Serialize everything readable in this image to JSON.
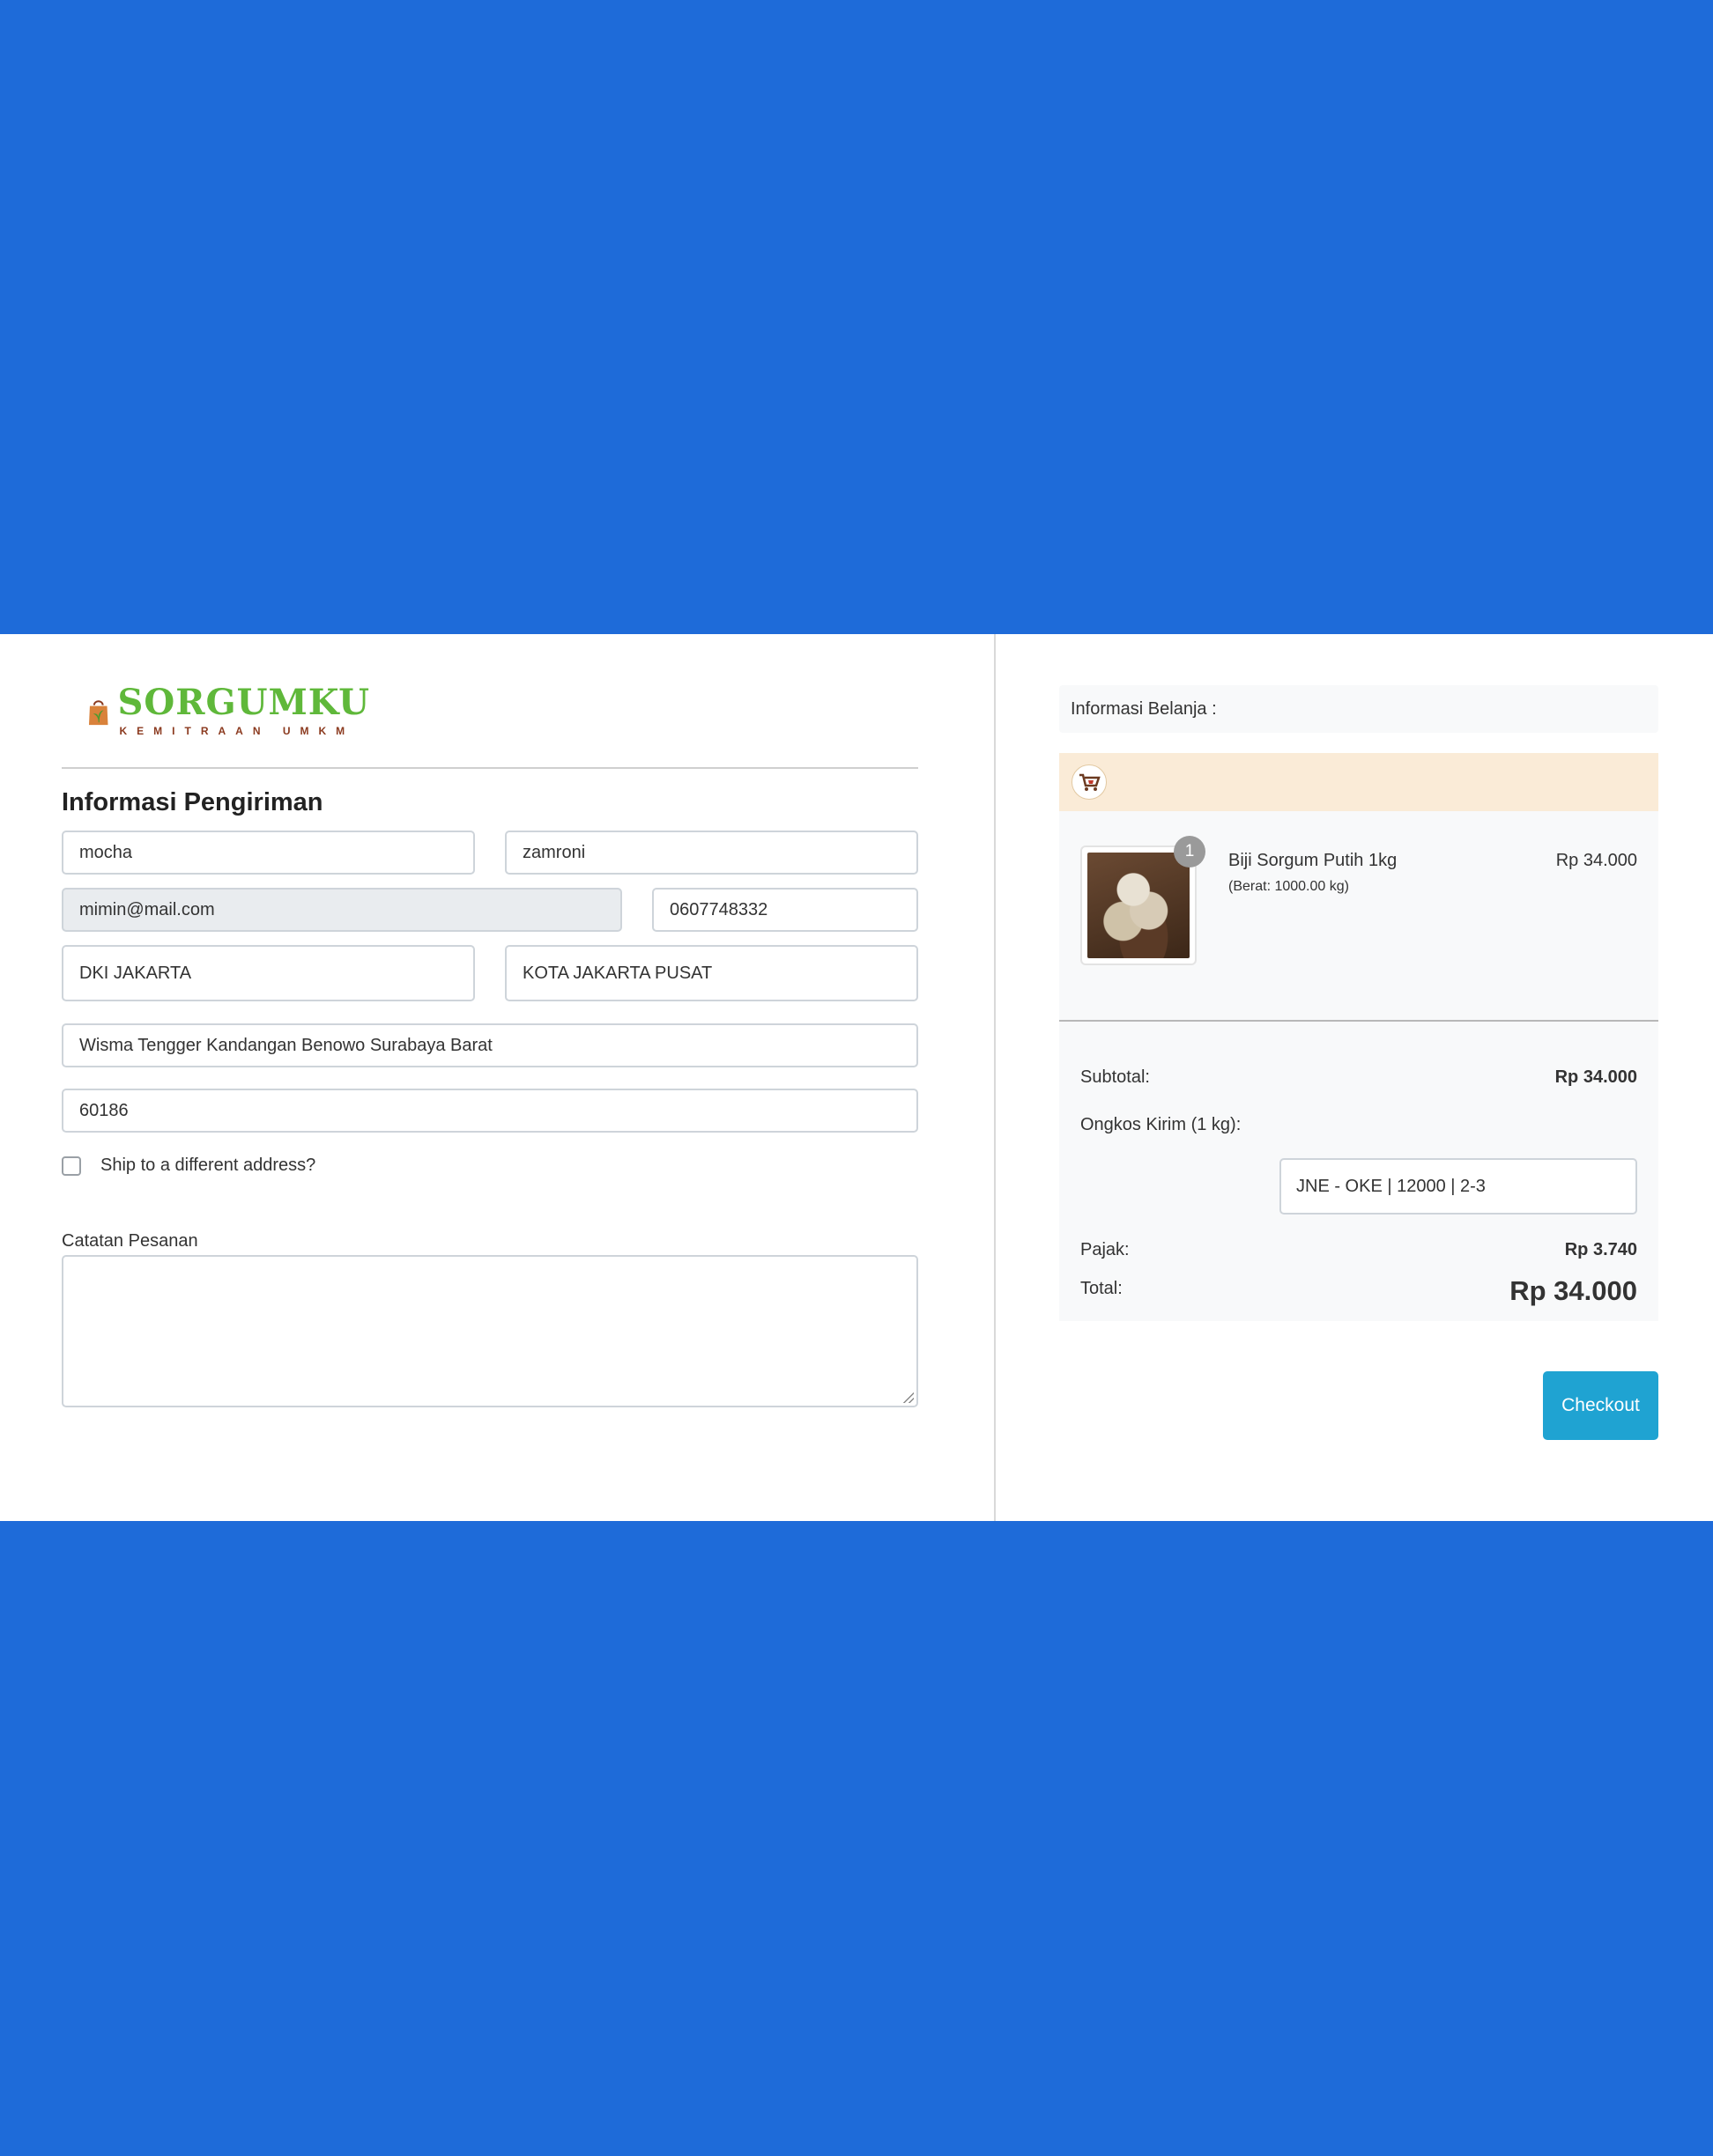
{
  "brand": {
    "name": "SORGUMKU",
    "tagline": "KEMITRAAN UMKM"
  },
  "shipping_form": {
    "title": "Informasi Pengiriman",
    "first_name": "mocha",
    "last_name": "zamroni",
    "email": "mimin@mail.com",
    "phone": "0607748332",
    "province": "DKI JAKARTA",
    "city": "KOTA JAKARTA PUSAT",
    "address": "Wisma Tengger Kandangan Benowo Surabaya Barat",
    "postal_code": "60186",
    "ship_different_label": "Ship to a different address?",
    "notes_label": "Catatan Pesanan",
    "notes_value": ""
  },
  "cart": {
    "header": "Informasi Belanja :",
    "items": [
      {
        "name": "Biji Sorgum Putih 1kg",
        "weight": "(Berat: 1000.00 kg)",
        "price": "Rp 34.000",
        "quantity": "1"
      }
    ]
  },
  "summary": {
    "subtotal_label": "Subtotal:",
    "subtotal_value": "Rp 34.000",
    "shipping_label": "Ongkos Kirim (1 kg):",
    "shipping_option": "JNE - OKE | 12000 | 2-3",
    "tax_label": "Pajak:",
    "tax_value": "Rp 3.740",
    "total_label": "Total:",
    "total_value": "Rp 34.000"
  },
  "actions": {
    "checkout_label": "Checkout"
  },
  "colors": {
    "page_background": "#1e6bd9",
    "brand_green": "#5fb83a",
    "brand_brown": "#8b3a1f",
    "shop_bar": "#faebd7",
    "checkout_button": "#1fa3d2",
    "readonly_field": "#e9ecef"
  }
}
